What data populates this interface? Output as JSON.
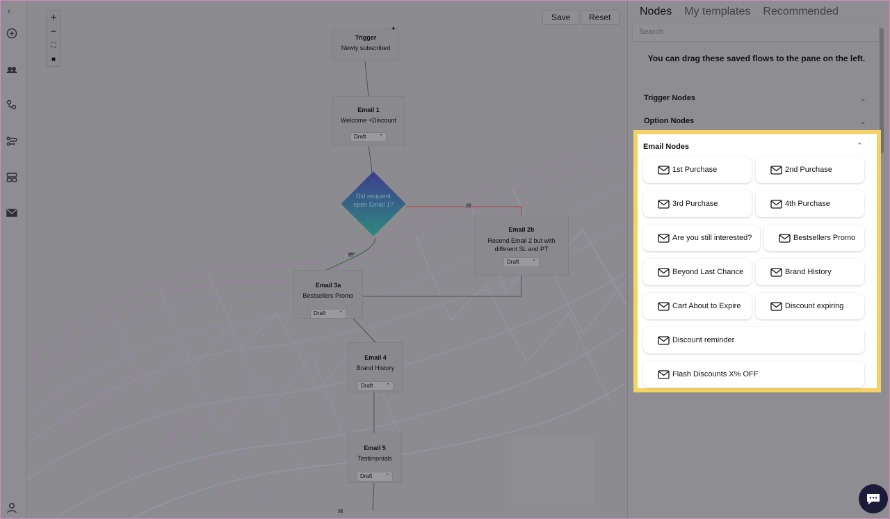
{
  "rail": {
    "collapse_icon": "chevron-left-icon",
    "items": [
      "add-circle-icon",
      "users-icon",
      "flow-icon",
      "workflow-icon",
      "templates-icon",
      "mail-icon"
    ],
    "account_icon": "user-icon"
  },
  "toolbar": {
    "save_label": "Save",
    "reset_label": "Reset"
  },
  "zoom": {
    "in": "+",
    "out": "−",
    "fit": "⛶",
    "lock": "🔒"
  },
  "flow": {
    "trigger": {
      "title": "Trigger",
      "subtitle": "Newly subscribed"
    },
    "email1": {
      "title": "Email 1",
      "subtitle": "Welcome +Discount",
      "status": "Draft"
    },
    "condition": {
      "text": "Did recipient open Email 1?"
    },
    "edge_no": "no",
    "edge_yes": "yes",
    "email2b": {
      "title": "Email 2b",
      "subtitle": "Resend Email 2 but with different SL and PT",
      "status": "Draft"
    },
    "email3a": {
      "title": "Email 3a",
      "subtitle": "Bestsellers Promo",
      "status": "Draft"
    },
    "email4": {
      "title": "Email 4",
      "subtitle": "Brand History",
      "status": "Draft"
    },
    "email5": {
      "title": "Email 5",
      "subtitle": "Testimonials",
      "status": "Draft"
    }
  },
  "panel": {
    "tabs": [
      "Nodes",
      "My templates",
      "Recommended"
    ],
    "search_placeholder": "Search",
    "hint": "You can drag these saved flows to the pane on the left.",
    "sections": {
      "trigger": "Trigger Nodes",
      "option": "Option Nodes",
      "email": "Email Nodes"
    },
    "email_nodes": [
      "1st Purchase",
      "2nd Purchase",
      "3rd Purchase",
      "4th Purchase",
      "Are you still interested?",
      "Bestsellers Promo",
      "Beyond Last Chance",
      "Brand History",
      "Cart About to Expire",
      "Discount expiring",
      "Discount reminder",
      "Flash Discounts X% OFF"
    ]
  },
  "colors": {
    "highlight": "#f5d265",
    "chat_button": "#1c1c3a"
  },
  "chat_icon": "chat-bubble-icon"
}
